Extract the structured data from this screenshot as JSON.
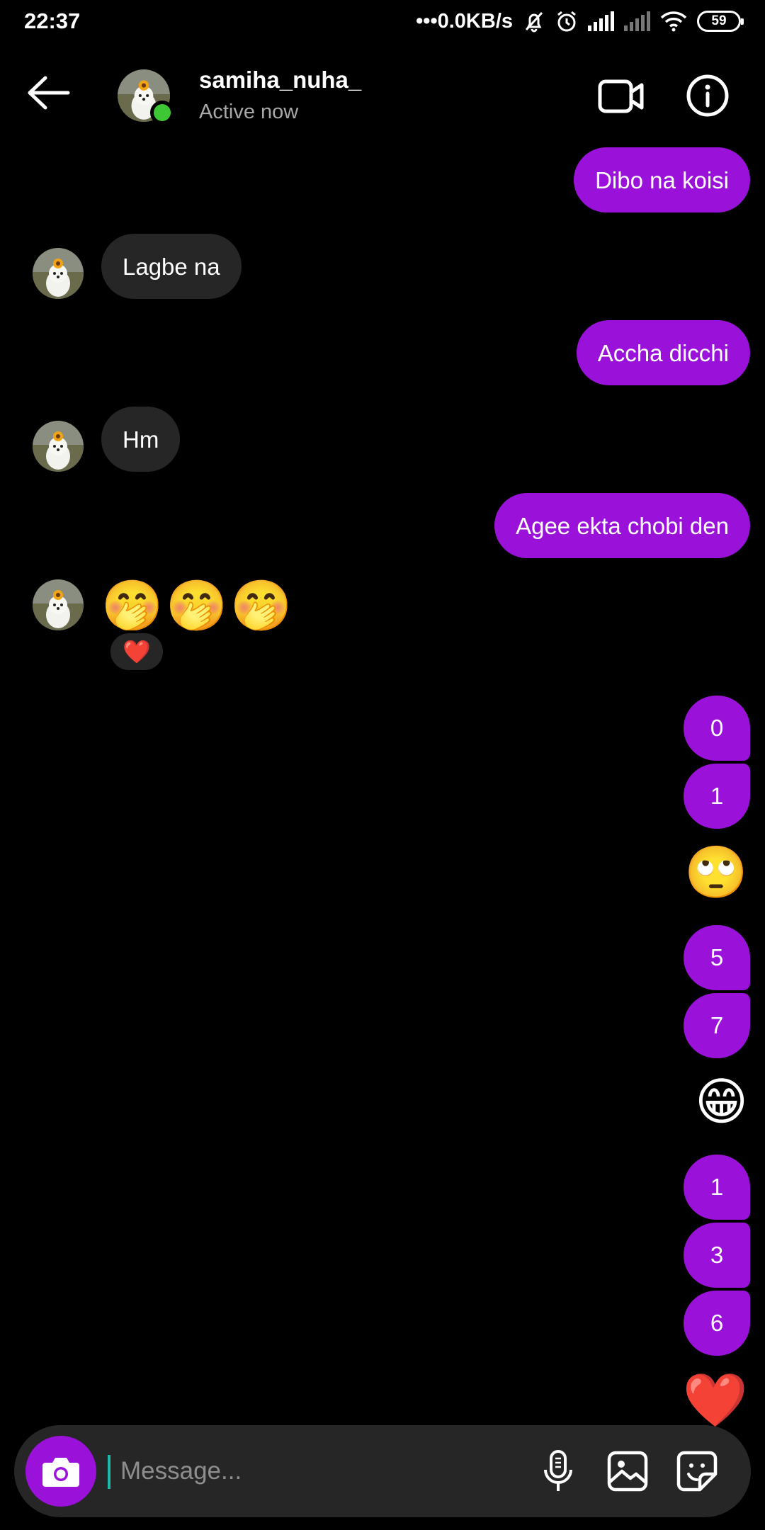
{
  "status_bar": {
    "time": "22:37",
    "network_speed": "•••0.0KB/s",
    "battery": "59"
  },
  "header": {
    "username": "samiha_nuha_",
    "status": "Active now"
  },
  "messages": {
    "out_1": "Dibo na koisi",
    "in_1": "Lagbe na",
    "out_2": "Accha dicchi",
    "in_2": "Hm",
    "out_3": "Agee ekta chobi den",
    "in_3_emoji": "🤭🤭🤭",
    "reaction": "❤️",
    "seq": [
      "0",
      "1",
      "🙄",
      "5",
      "7",
      "😁",
      "1",
      "3",
      "6",
      "❤️"
    ]
  },
  "composer": {
    "placeholder": "Message..."
  },
  "colors": {
    "outgoing_bubble": "#9a12d9",
    "incoming_bubble": "#262626",
    "online": "#3ec735"
  }
}
